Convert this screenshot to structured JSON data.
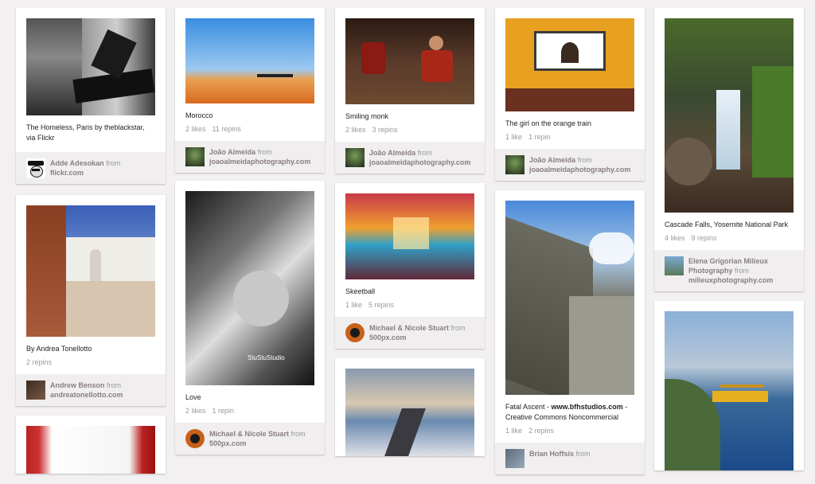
{
  "pins": [
    {
      "desc": "The Homeless, Paris by theblackstar, via Flickr",
      "likes": "",
      "repins": "",
      "user": "Adde Adesokan",
      "from": "from",
      "source": "flickr.com"
    },
    {
      "desc": "Morocco",
      "likes": "2 likes",
      "repins": "11 repins",
      "user": "João Almeida",
      "from": "from",
      "source": "joaoalmeidaphotography.com"
    },
    {
      "desc": "Smiling monk",
      "likes": "2 likes",
      "repins": "3 repins",
      "user": "João Almeida",
      "from": "from",
      "source": "joaoalmeidaphotography.com"
    },
    {
      "desc": "The girl on the orange train",
      "likes": "1 like",
      "repins": "1 repin",
      "user": "João Almeida",
      "from": "from",
      "source": "joaoalmeidaphotography.com"
    },
    {
      "desc": "Cascade Falls, Yosemite National Park",
      "likes": "4 likes",
      "repins": "9 repins",
      "user": "Elena Grigorian Milieux Photography",
      "from": "from",
      "source": "milieuxphotography.com"
    },
    {
      "desc": "By Andrea Tonellotto",
      "likes": "",
      "repins": "2 repins",
      "user": "Andrew Benson",
      "from": "from",
      "source": "andreatonellotto.com"
    },
    {
      "desc": "Love",
      "likes": "2 likes",
      "repins": "1 repin",
      "user": "Michael & Nicole Stuart",
      "from": "from",
      "source": "500px.com"
    },
    {
      "desc": "Skeetball",
      "likes": "1 like",
      "repins": "5 repins",
      "user": "Michael & Nicole Stuart",
      "from": "from",
      "source": "500px.com"
    },
    {
      "desc_bold": "www.bfhstudios.com",
      "desc_pre": "Fatal Ascent - ",
      "desc_post": " - Creative Commons Noncommercial",
      "likes": "1 like",
      "repins": "2 repins",
      "user": "Brian Hoffsis",
      "from": "from",
      "source": ""
    }
  ],
  "watermark": "StuStuStudio",
  "colors": {
    "background": "#f2f0f0",
    "card": "#ffffff",
    "attribution_bg": "#f0eeee",
    "user_text": "#8a7f7f",
    "meta_text": "#999999"
  }
}
